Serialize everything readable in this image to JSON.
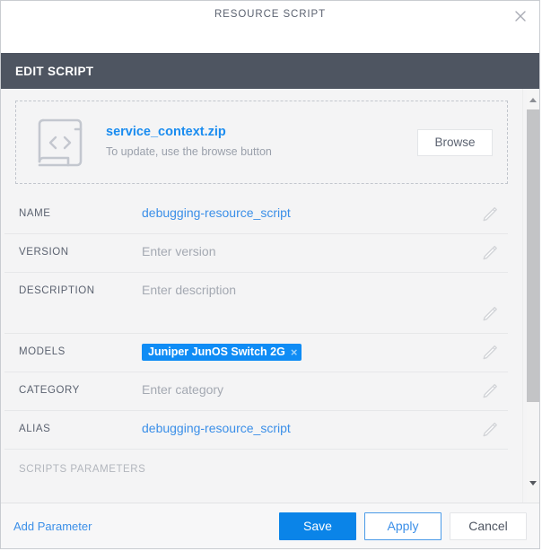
{
  "window": {
    "title": "RESOURCE SCRIPT",
    "close_icon": "close-icon"
  },
  "section": {
    "title": "EDIT SCRIPT"
  },
  "dropzone": {
    "file_icon": "code-file-icon",
    "filename": "service_context.zip",
    "hint": "To update, use the browse button",
    "browse_label": "Browse"
  },
  "fields": [
    {
      "label": "NAME",
      "value": "debugging-resource_script",
      "kind": "link",
      "edit_icon": "pencil-icon"
    },
    {
      "label": "VERSION",
      "value": "Enter version",
      "kind": "placeholder",
      "edit_icon": "pencil-icon"
    },
    {
      "label": "DESCRIPTION",
      "value": "Enter description",
      "kind": "placeholder",
      "edit_icon": "pencil-icon"
    },
    {
      "label": "MODELS",
      "value": "Juniper JunOS Switch 2G",
      "kind": "chip",
      "chip_remove": "×",
      "edit_icon": "pencil-icon"
    },
    {
      "label": "CATEGORY",
      "value": "Enter category",
      "kind": "placeholder",
      "edit_icon": "pencil-icon"
    },
    {
      "label": "ALIAS",
      "value": "debugging-resource_script",
      "kind": "link",
      "edit_icon": "pencil-icon"
    }
  ],
  "params_section": {
    "title": "SCRIPTS PARAMETERS"
  },
  "scrollbar": {
    "up_icon": "caret-up-icon",
    "down_icon": "caret-down-icon",
    "thumb": "scrollbar-thumb"
  },
  "footer": {
    "add_parameter_label": "Add Parameter",
    "save_label": "Save",
    "apply_label": "Apply",
    "cancel_label": "Cancel"
  },
  "colors": {
    "header_bar": "#4e5561",
    "accent_blue": "#0a84e8",
    "link_blue": "#3b8fe8",
    "chip_blue": "#0f8cf5",
    "body_bg": "#f4f4f5",
    "label_gray": "#5b6270",
    "placeholder_gray": "#a4a9b2"
  }
}
